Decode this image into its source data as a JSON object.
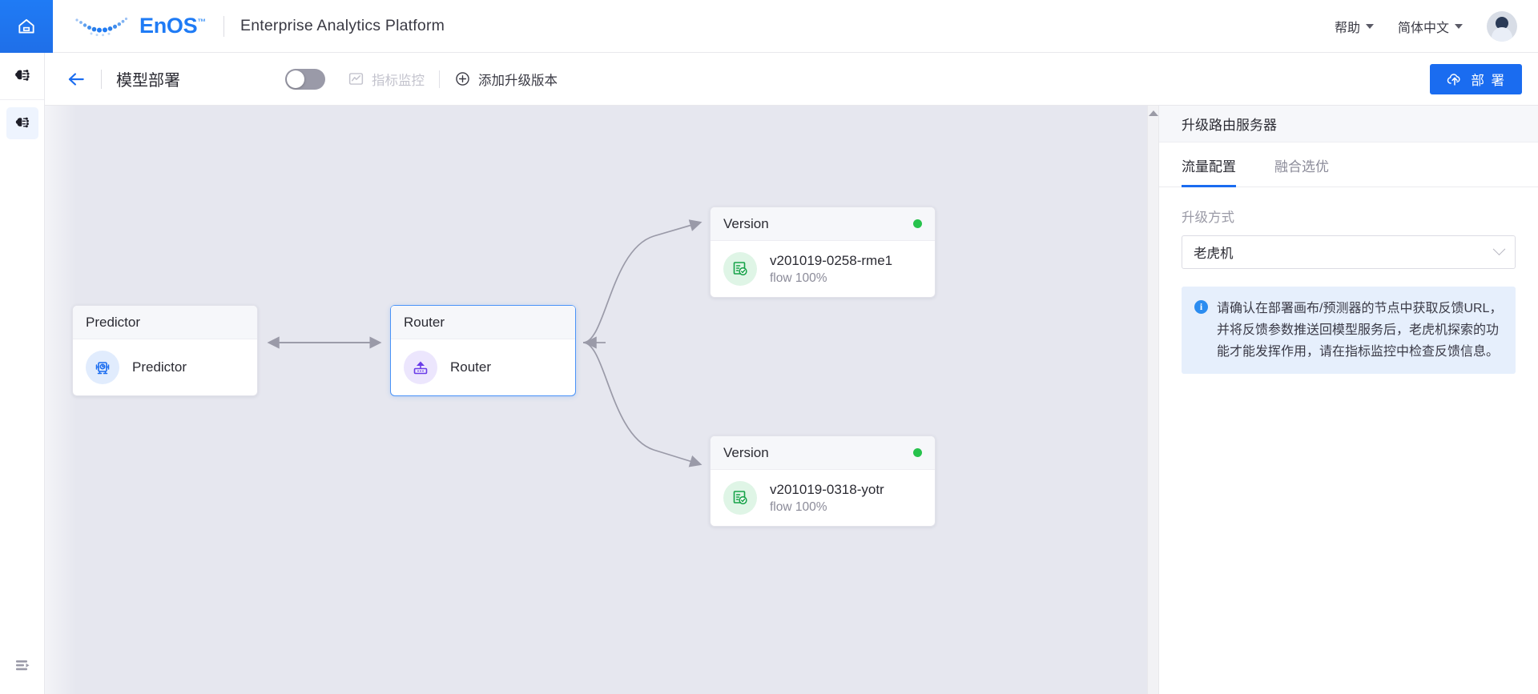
{
  "header": {
    "home_icon": "home-icon",
    "brand": {
      "logo_mark": "enos-dots-logo",
      "name_bold": "EnOS",
      "trademark": "™"
    },
    "product_name": "Enterprise Analytics Platform",
    "help_label": "帮助",
    "language_label": "简体中文",
    "avatar_icon": "user-avatar"
  },
  "rail": {
    "items": [
      {
        "icon": "ai-model-icon",
        "active": false
      },
      {
        "icon": "ai-model-icon",
        "active": true
      }
    ],
    "collapse_icon": "collapse-panel-icon"
  },
  "toolbar": {
    "back_icon": "back-arrow-icon",
    "title": "模型部署",
    "toggle": {
      "name": "metric-monitor-toggle",
      "state": "off"
    },
    "monitor_label": "指标监控",
    "monitor_icon": "chart-monitor-icon",
    "add_version_label": "添加升级版本",
    "add_version_icon": "plus-circle-icon",
    "deploy_label": "部 署",
    "deploy_icon": "cloud-upload-icon"
  },
  "canvas": {
    "nodes": [
      {
        "type": "predictor",
        "header": "Predictor",
        "label": "Predictor",
        "sub": "",
        "icon": "predictor-icon",
        "selected": false,
        "status": ""
      },
      {
        "type": "router",
        "header": "Router",
        "label": "Router",
        "sub": "",
        "icon": "router-icon",
        "selected": true,
        "status": ""
      },
      {
        "type": "version",
        "header": "Version",
        "label": "v201019-0258-rme1",
        "sub": "flow 100%",
        "icon": "version-check-icon",
        "selected": false,
        "status": "online"
      },
      {
        "type": "version",
        "header": "Version",
        "label": "v201019-0318-yotr",
        "sub": "flow 100%",
        "icon": "version-check-icon",
        "selected": false,
        "status": "online"
      }
    ],
    "status_color": "#27c24c",
    "scrollbar_up_icon": "scroll-up-arrow"
  },
  "panel": {
    "title": "升级路由服务器",
    "tabs": [
      {
        "label": "流量配置",
        "active": true
      },
      {
        "label": "融合选优",
        "active": false
      }
    ],
    "field_label": "升级方式",
    "select_value": "老虎机",
    "select_chevron_icon": "chevron-down-icon",
    "info_icon": "info-icon",
    "info_text": "请确认在部署画布/预测器的节点中获取反馈URL，并将反馈参数推送回模型服务后，老虎机探索的功能才能发挥作用，请在指标监控中检查反馈信息。"
  },
  "colors": {
    "accent": "#1a6cf0",
    "status_green": "#27c24c",
    "canvas_bg": "#e6e7ef"
  }
}
